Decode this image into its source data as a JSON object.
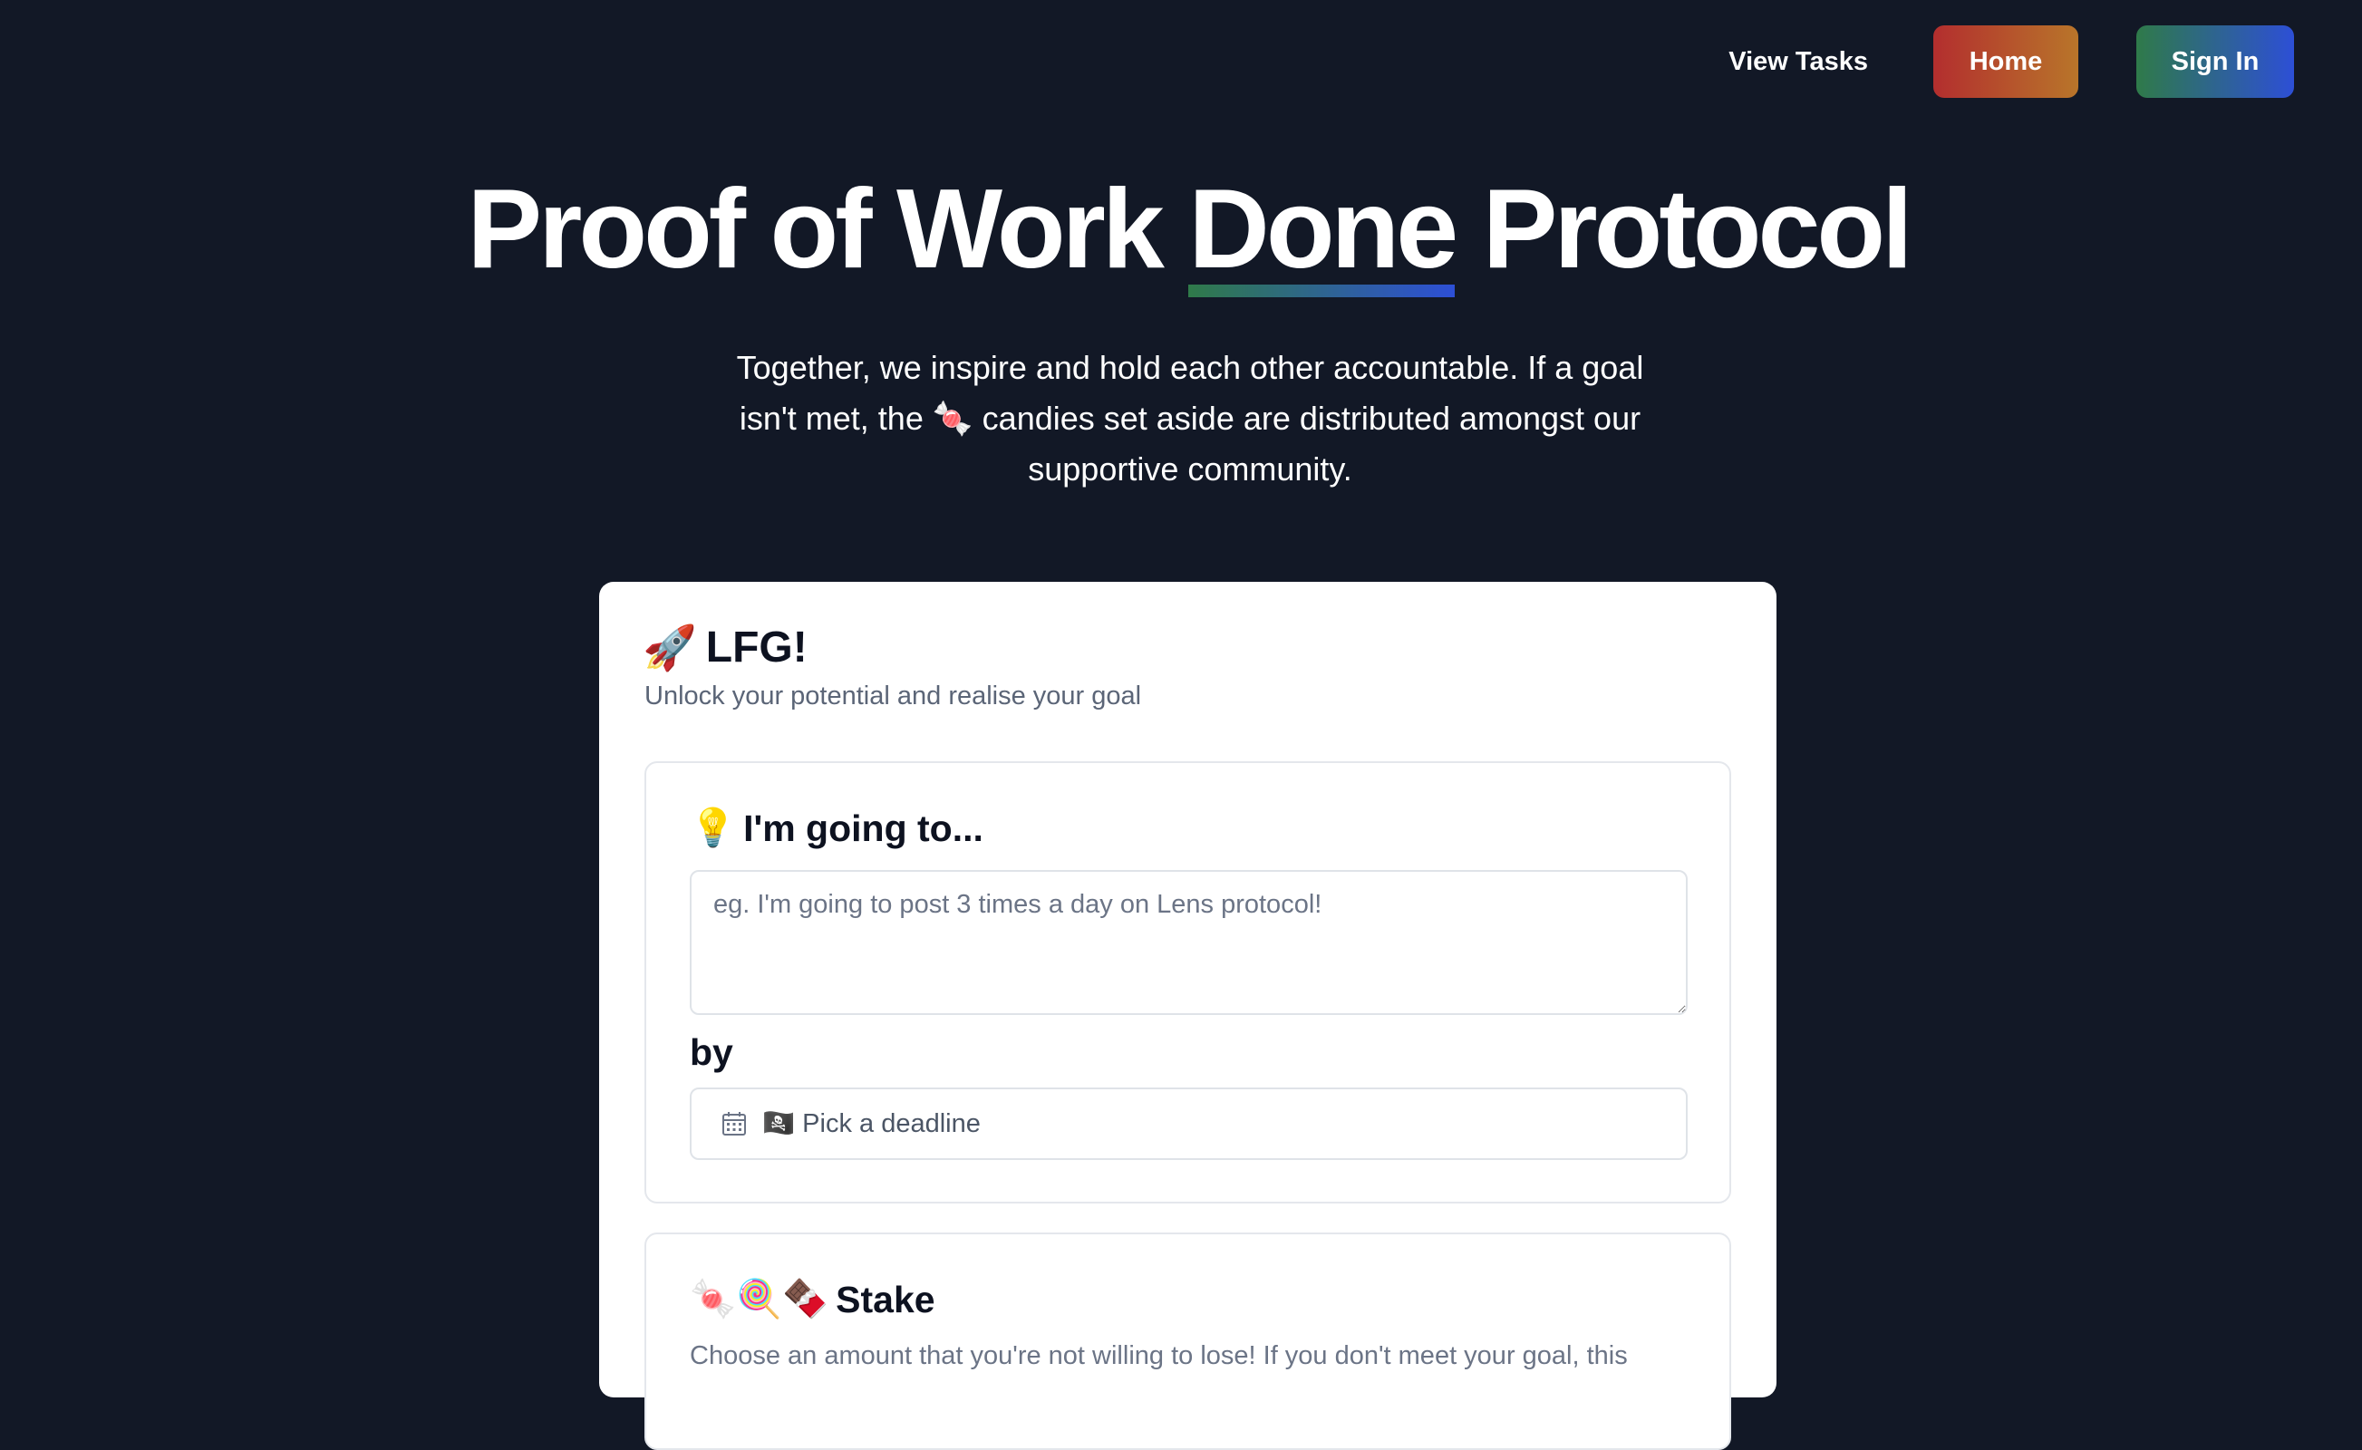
{
  "nav": {
    "view_tasks": "View Tasks",
    "home": "Home",
    "sign_in": "Sign In"
  },
  "hero": {
    "title_before": "Proof of Work ",
    "title_highlight": "Done",
    "title_after": " Protocol",
    "subtitle": "Together, we inspire and hold each other accountable. If a goal isn't met, the 🍬 candies set aside are distributed amongst our supportive community."
  },
  "card": {
    "title_icon": "🚀",
    "title": "LFG!",
    "subtitle": "Unlock your potential and realise your goal",
    "goal_section": {
      "icon": "💡",
      "heading": "I'm going to...",
      "placeholder": "eg. I'm going to post 3 times a day on Lens protocol!",
      "value": "",
      "by_label": "by",
      "deadline_icon": "🏴‍☠️",
      "deadline_placeholder": "Pick a deadline"
    },
    "stake_section": {
      "icons": "🍬🍭🍫",
      "heading": "Stake",
      "description": "Choose an amount that you're not willing to lose! If you don't meet your goal, this"
    }
  },
  "colors": {
    "background": "#121826",
    "home_gradient_start": "#b32e2e",
    "home_gradient_end": "#b8752a",
    "signin_gradient_start": "#2f7a49",
    "signin_gradient_end": "#2d4fd6"
  }
}
